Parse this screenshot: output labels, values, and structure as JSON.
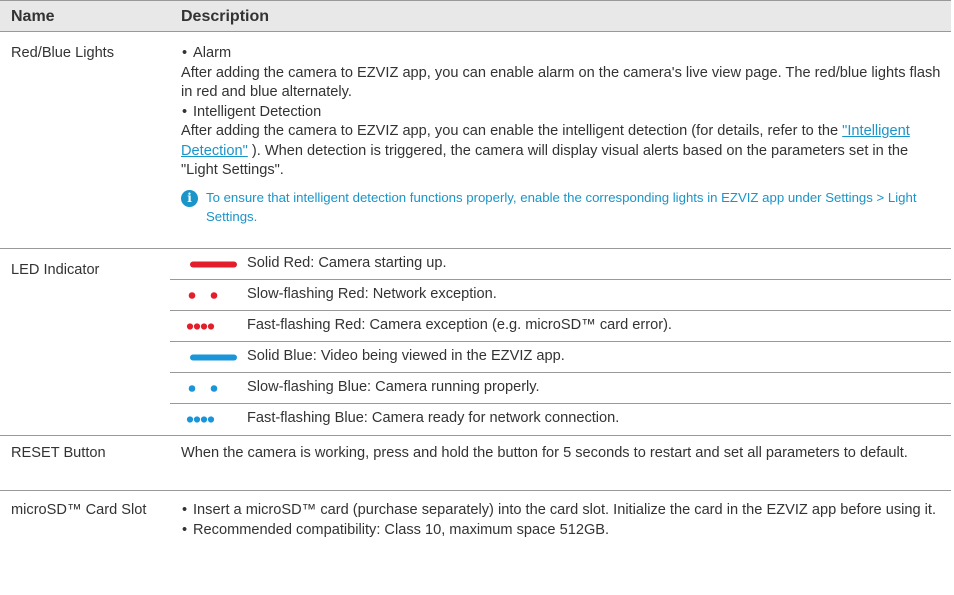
{
  "colors": {
    "red": "#e31f2b",
    "blue": "#1a95d9",
    "note": "#1a95c9",
    "header_bg": "#e8e8e8"
  },
  "header": {
    "name": "Name",
    "description": "Description"
  },
  "rows": {
    "lights": {
      "name": "Red/Blue Lights",
      "b1_title": "Alarm",
      "b1_text": "After adding the camera to EZVIZ app, you can enable alarm on the camera's live view page. The red/blue lights flash in red and blue alternately.",
      "b2_title": "Intelligent Detection",
      "b2_pre": "After adding the camera to EZVIZ app, you can enable the intelligent detection (for details, refer to the ",
      "b2_link": "\"Intelligent Detection\"",
      "b2_post": " ). When detection is triggered, the camera will display visual alerts based on the parameters set in the \"Light Settings\".",
      "note_icon": "info-icon",
      "note": "To ensure that intelligent detection functions properly, enable the corresponding lights in EZVIZ app under Settings > Light Settings."
    },
    "led": {
      "name": "LED Indicator",
      "items": [
        {
          "pattern": "solid",
          "color": "red",
          "text": "Solid Red: Camera starting up."
        },
        {
          "pattern": "slow",
          "color": "red",
          "text": "Slow-flashing Red: Network exception."
        },
        {
          "pattern": "fast",
          "color": "red",
          "text": "Fast-flashing Red: Camera exception (e.g. microSD™ card error)."
        },
        {
          "pattern": "solid",
          "color": "blue",
          "text": "Solid Blue: Video being viewed in the EZVIZ app."
        },
        {
          "pattern": "slow",
          "color": "blue",
          "text": "Slow-flashing Blue: Camera running properly."
        },
        {
          "pattern": "fast",
          "color": "blue",
          "text": "Fast-flashing Blue: Camera ready for network connection."
        }
      ]
    },
    "reset": {
      "name": "RESET Button",
      "text": "When the camera is working, press and hold the button for 5 seconds to restart and set all parameters to default."
    },
    "sd": {
      "name": "microSD™ Card Slot",
      "b1": "Insert a microSD™ card (purchase separately) into the card slot. Initialize the card in the EZVIZ app before using it.",
      "b2": "Recommended compatibility: Class 10, maximum space 512GB."
    }
  }
}
